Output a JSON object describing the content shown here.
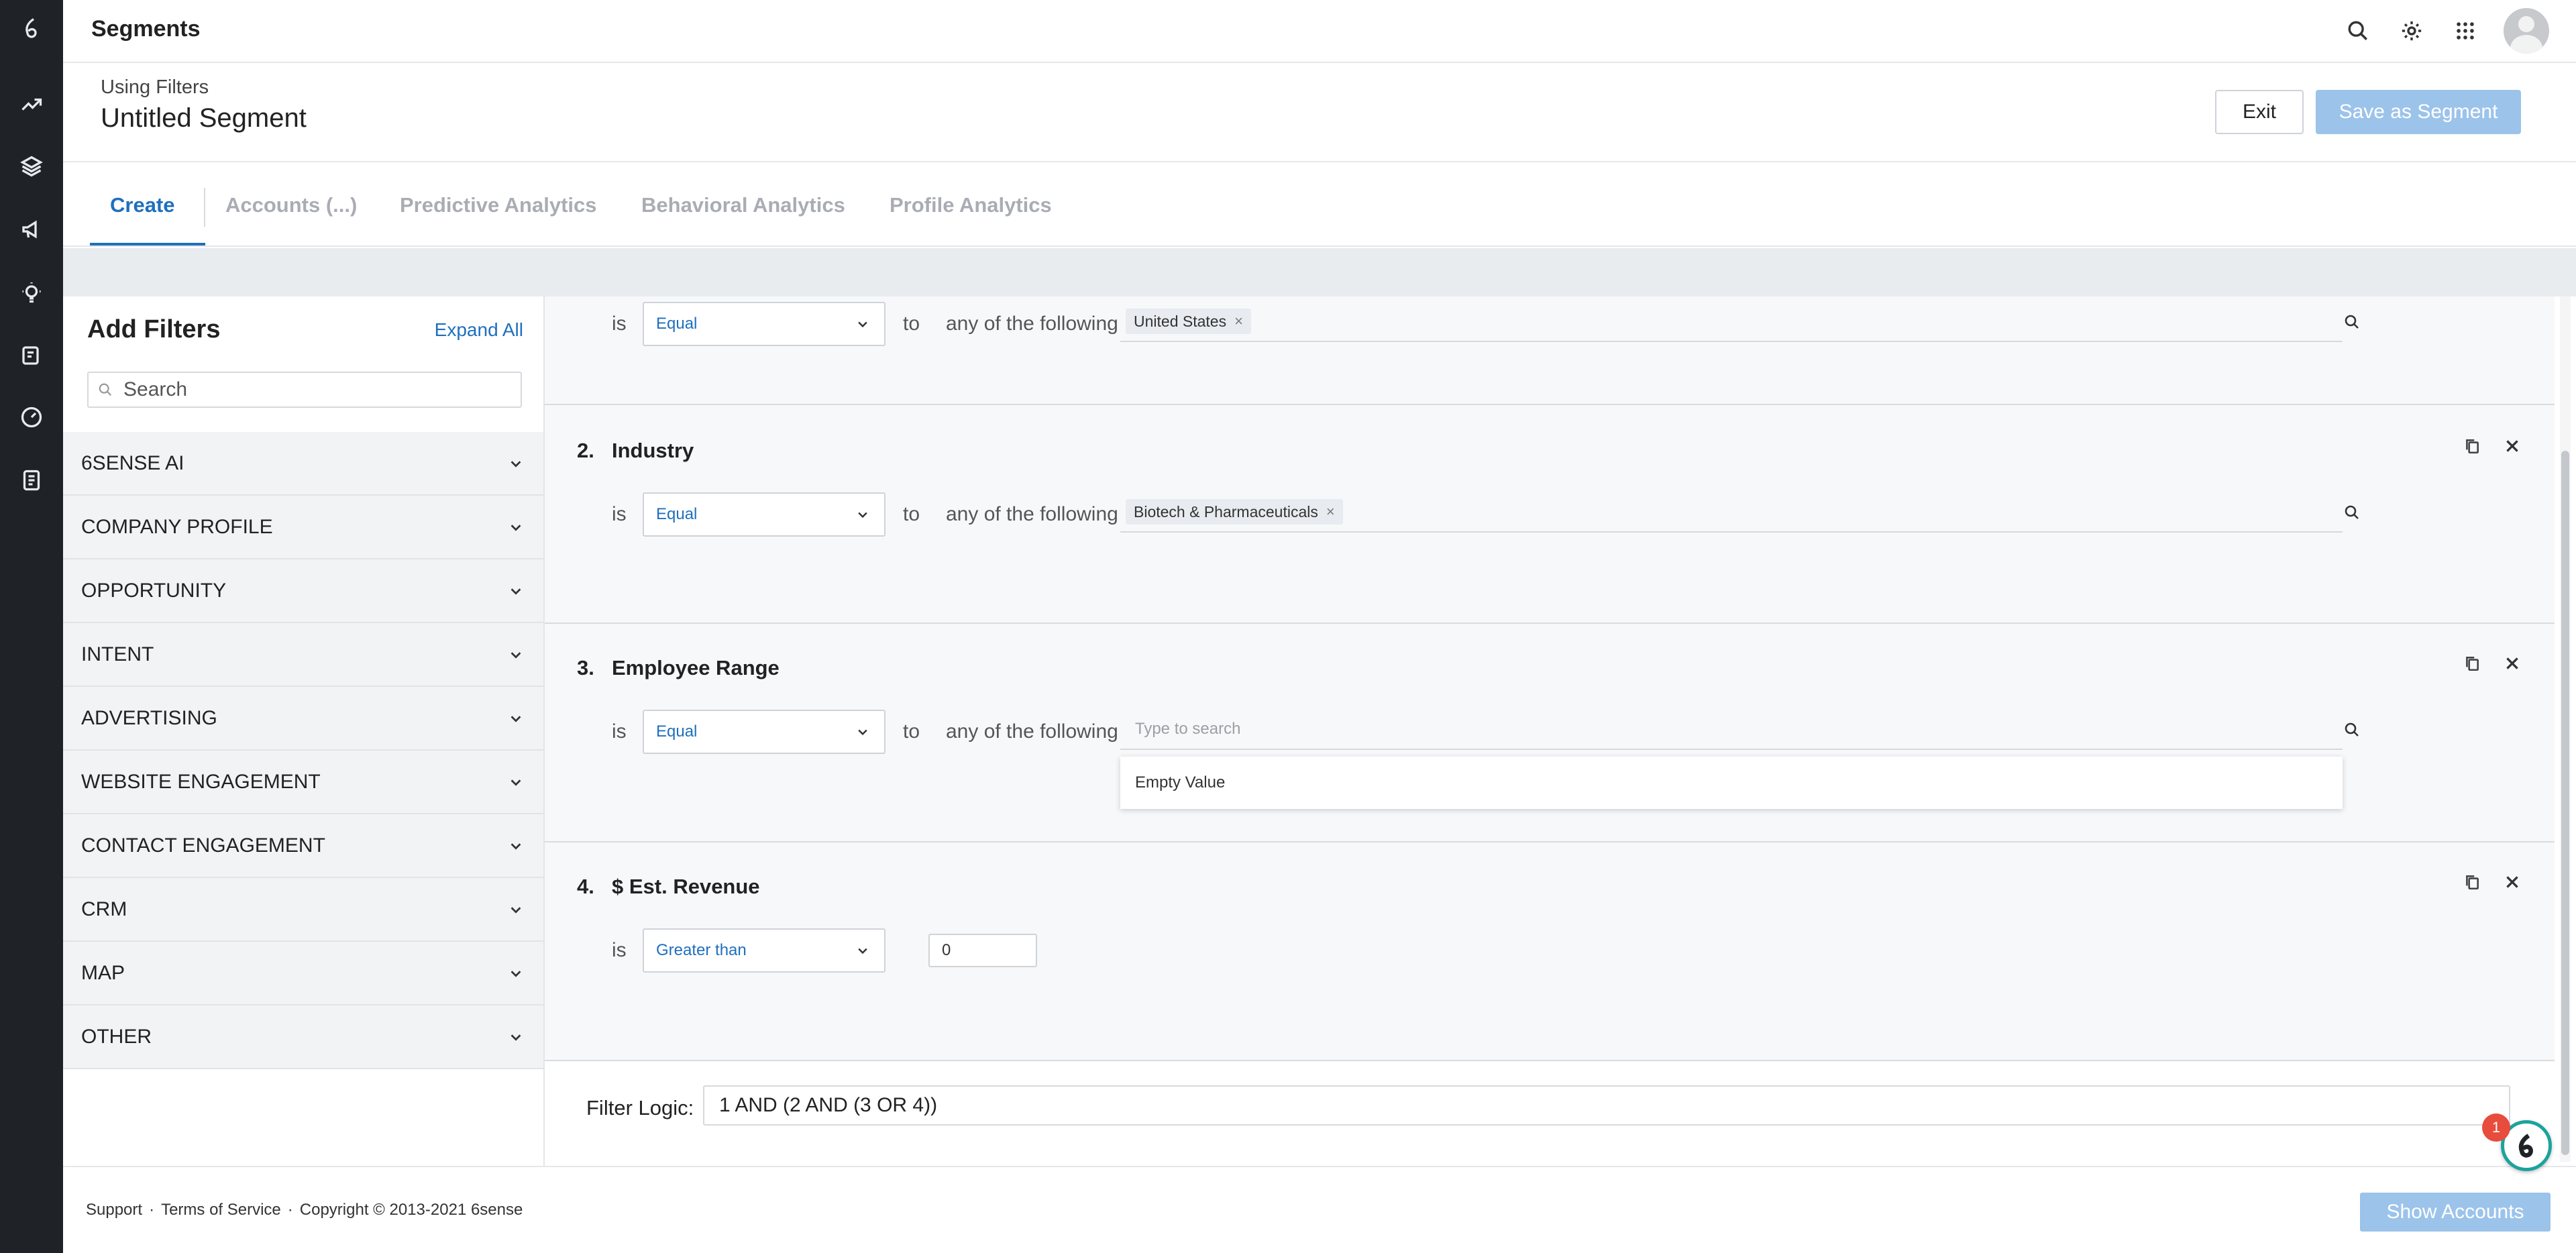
{
  "app": {
    "title": "Segments"
  },
  "segment": {
    "subtitle": "Using Filters",
    "name": "Untitled Segment"
  },
  "actions": {
    "exit": "Exit",
    "save": "Save as Segment",
    "show_accounts": "Show Accounts"
  },
  "tabs": [
    {
      "label": "Create",
      "active": true
    },
    {
      "label": "Accounts (...)"
    },
    {
      "label": "Predictive Analytics"
    },
    {
      "label": "Behavioral Analytics"
    },
    {
      "label": "Profile Analytics"
    }
  ],
  "left_panel": {
    "title": "Add Filters",
    "expand_all": "Expand All",
    "search_placeholder": "Search",
    "categories": [
      "6SENSE AI",
      "COMPANY PROFILE",
      "OPPORTUNITY",
      "INTENT",
      "ADVERTISING",
      "WEBSITE ENGAGEMENT",
      "CONTACT ENGAGEMENT",
      "CRM",
      "MAP",
      "OTHER"
    ]
  },
  "filters": [
    {
      "operator_prefix": "is",
      "operator": "Equal",
      "connector": "to",
      "any_label": "any of the following",
      "chips": [
        "United States"
      ]
    },
    {
      "number": "2.",
      "name": "Industry",
      "operator_prefix": "is",
      "operator": "Equal",
      "connector": "to",
      "any_label": "any of the following",
      "chips": [
        "Biotech & Pharmaceuticals"
      ]
    },
    {
      "number": "3.",
      "name": "Employee Range",
      "operator_prefix": "is",
      "operator": "Equal",
      "connector": "to",
      "any_label": "any of the following",
      "search_placeholder": "Type to search",
      "dropdown_option": "Empty Value"
    },
    {
      "number": "4.",
      "name": "$ Est. Revenue",
      "operator_prefix": "is",
      "operator": "Greater than",
      "value": "0"
    }
  ],
  "filter_logic": {
    "label": "Filter Logic:",
    "value": "1 AND (2 AND (3 OR 4))"
  },
  "footer": {
    "support": "Support",
    "sep": "·",
    "terms": "Terms of Service",
    "copyright": "Copyright © 2013-2021 6sense"
  },
  "notification": {
    "count": "1"
  },
  "colors": {
    "accent": "#1f6fbd",
    "rail": "#1f2328",
    "disabled_button": "#9cc3ea",
    "badge": "#e74c3c"
  }
}
